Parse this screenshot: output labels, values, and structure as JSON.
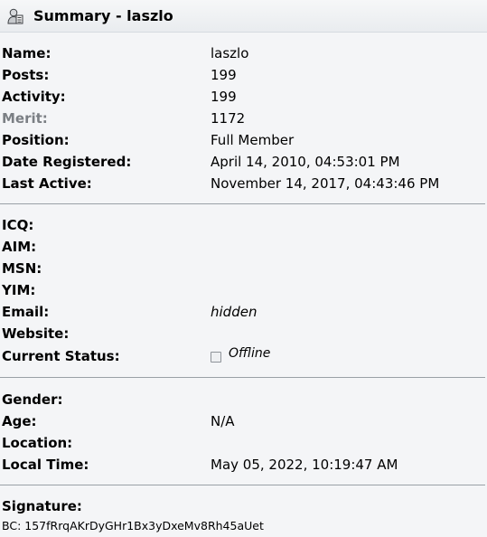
{
  "header": {
    "title": "Summary - laszlo",
    "icon": "user-profile-icon"
  },
  "summary": [
    {
      "label": "Name:",
      "value": "laszlo"
    },
    {
      "label": "Posts:",
      "value": "199"
    },
    {
      "label": "Activity:",
      "value": "199"
    },
    {
      "label": "Merit:",
      "value": "1172"
    },
    {
      "label": "Position:",
      "value": "Full Member"
    },
    {
      "label": "Date Registered:",
      "value": "April 14, 2010, 04:53:01 PM"
    },
    {
      "label": "Last Active:",
      "value": "November 14, 2017, 04:43:46 PM"
    }
  ],
  "contact": [
    {
      "label": "ICQ:",
      "value": ""
    },
    {
      "label": "AIM:",
      "value": ""
    },
    {
      "label": "MSN:",
      "value": ""
    },
    {
      "label": "YIM:",
      "value": ""
    },
    {
      "label": "Email:",
      "value": "hidden"
    },
    {
      "label": "Website:",
      "value": ""
    },
    {
      "label": "Current Status:",
      "value": "Offline"
    }
  ],
  "personal": [
    {
      "label": "Gender:",
      "value": ""
    },
    {
      "label": "Age:",
      "value": "N/A"
    },
    {
      "label": "Location:",
      "value": ""
    },
    {
      "label": "Local Time:",
      "value": "May 05, 2022, 10:19:47 AM"
    }
  ],
  "signature": {
    "label": "Signature:",
    "text": "BC: 157fRrqAKrDyGHr1Bx3yDxeMv8Rh45aUet"
  },
  "colors": {
    "merit_label": "#7b7f84",
    "divider": "#9aa0a6"
  }
}
